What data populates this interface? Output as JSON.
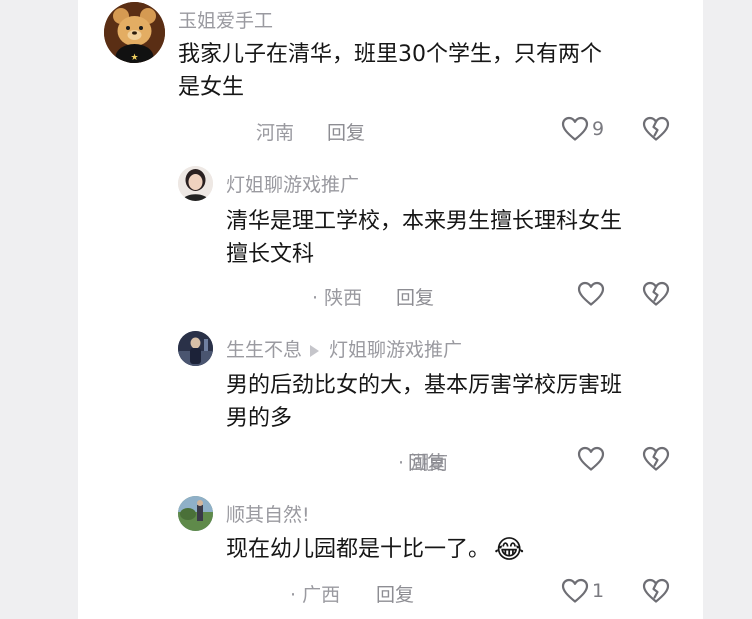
{
  "comments": [
    {
      "username": "玉姐爱手工",
      "text_lines": [
        "我家儿子在清华，班里30个学生，只有两个",
        "是女生"
      ],
      "location": "河南",
      "reply_label": "回复",
      "like_count": "9",
      "avatar_icon": "teddy-bear-avatar"
    },
    {
      "username": "灯姐聊游戏推广",
      "text_lines": [
        "清华是理工学校，本来男生擅长理科女生",
        "擅长文科"
      ],
      "location": "· 陕西",
      "reply_label": "回复",
      "avatar_icon": "woman-avatar"
    },
    {
      "username": "生生不息",
      "reply_to": "灯姐聊游戏推广",
      "text_lines": [
        "男的后劲比女的大，基本厉害学校厉害班",
        "男的多"
      ],
      "location": "· 湖南",
      "reply_label": "回复",
      "avatar_icon": "dark-figure-avatar"
    },
    {
      "username": "顺其自然!",
      "text_lines": [
        "现在幼儿园都是十比一了。"
      ],
      "emoji": "😂",
      "location": "· 广西",
      "reply_label": "回复",
      "like_count": "1",
      "avatar_icon": "landscape-avatar"
    }
  ],
  "icons": {
    "like": "heart-outline-icon",
    "dislike": "broken-heart-icon"
  }
}
